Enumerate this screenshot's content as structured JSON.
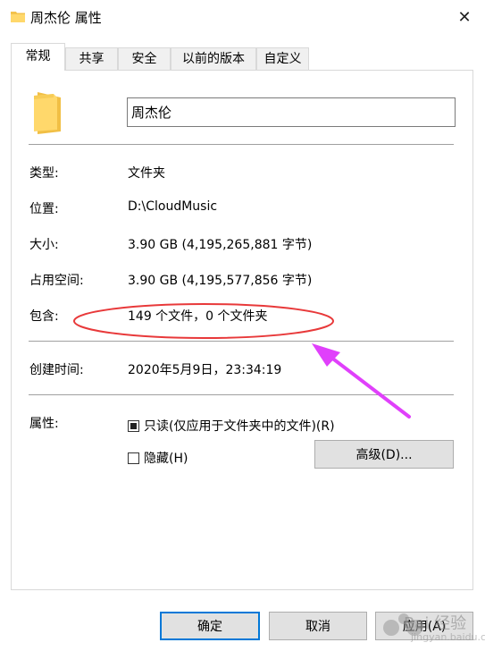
{
  "window": {
    "title": "周杰伦 属性",
    "close_glyph": "✕"
  },
  "tabs": [
    {
      "label": "常规",
      "active": true
    },
    {
      "label": "共享",
      "active": false
    },
    {
      "label": "安全",
      "active": false
    },
    {
      "label": "以前的版本",
      "active": false
    },
    {
      "label": "自定义",
      "active": false
    }
  ],
  "folder_name": "周杰伦",
  "properties": {
    "type_label": "类型:",
    "type_value": "文件夹",
    "location_label": "位置:",
    "location_value": "D:\\CloudMusic",
    "size_label": "大小:",
    "size_value": "3.90 GB (4,195,265,881 字节)",
    "disk_label": "占用空间:",
    "disk_value": "3.90 GB (4,195,577,856 字节)",
    "contains_label": "包含:",
    "contains_value": "149 个文件，0 个文件夹",
    "created_label": "创建时间:",
    "created_value": "2020年5月9日，23:34:19",
    "attributes_label": "属性:"
  },
  "attributes": {
    "readonly_label": "只读(仅应用于文件夹中的文件)(R)",
    "readonly_state": "indeterminate",
    "hidden_label": "隐藏(H)",
    "hidden_state": "unchecked",
    "advanced_label": "高级(D)..."
  },
  "buttons": {
    "ok": "确定",
    "cancel": "取消",
    "apply": "应用(A)"
  },
  "icons": [
    "folder-icon",
    "close-icon"
  ],
  "annotation_color": "#e8393a",
  "arrow_color": "#e040fb",
  "watermark": {
    "text": "Bai 经验",
    "sub": "jingyan.baidu.com"
  }
}
